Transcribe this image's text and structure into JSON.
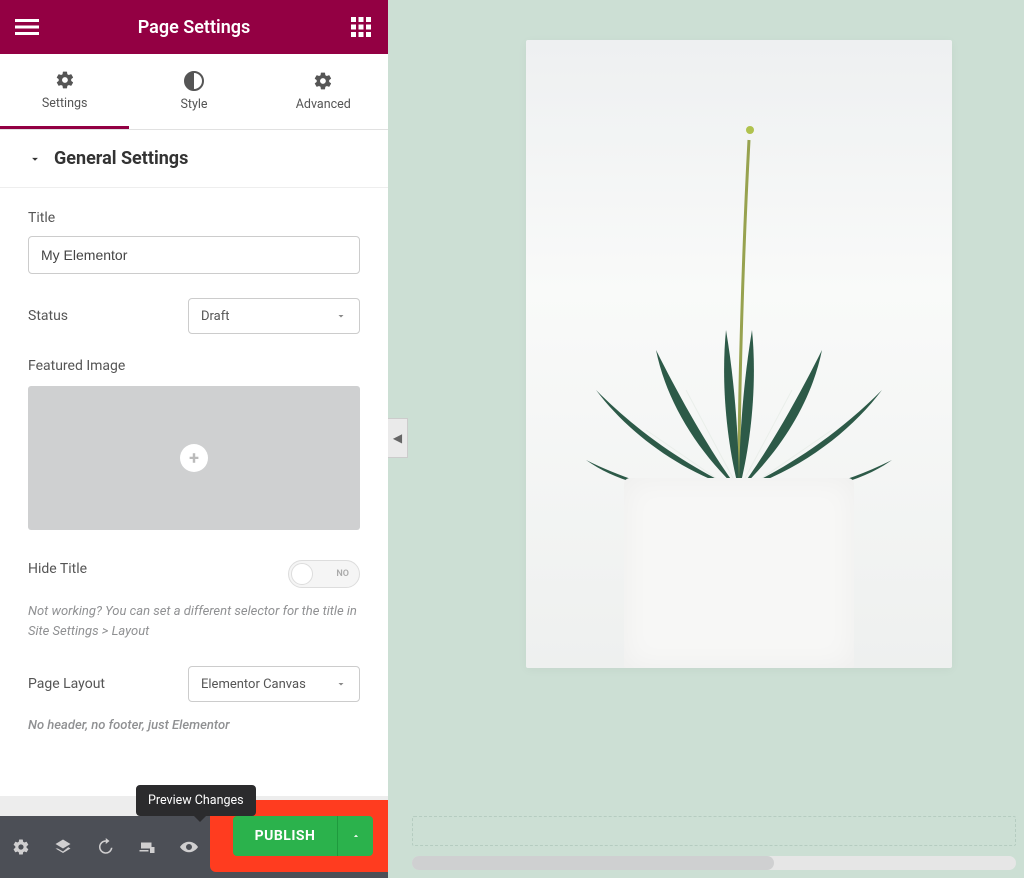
{
  "header": {
    "title": "Page Settings"
  },
  "tabs": [
    {
      "label": "Settings",
      "active": true
    },
    {
      "label": "Style",
      "active": false
    },
    {
      "label": "Advanced",
      "active": false
    }
  ],
  "section": {
    "title": "General Settings"
  },
  "fields": {
    "title_label": "Title",
    "title_value": "My Elementor",
    "status_label": "Status",
    "status_value": "Draft",
    "featured_label": "Featured Image",
    "hide_title_label": "Hide Title",
    "hide_title_toggle": "NO",
    "hide_title_help": "Not working? You can set a different selector for the title in Site Settings > Layout",
    "page_layout_label": "Page Layout",
    "page_layout_value": "Elementor Canvas",
    "page_layout_help": "No header, no footer, just Elementor"
  },
  "tooltip": {
    "preview": "Preview Changes"
  },
  "footer": {
    "publish": "PUBLISH"
  }
}
